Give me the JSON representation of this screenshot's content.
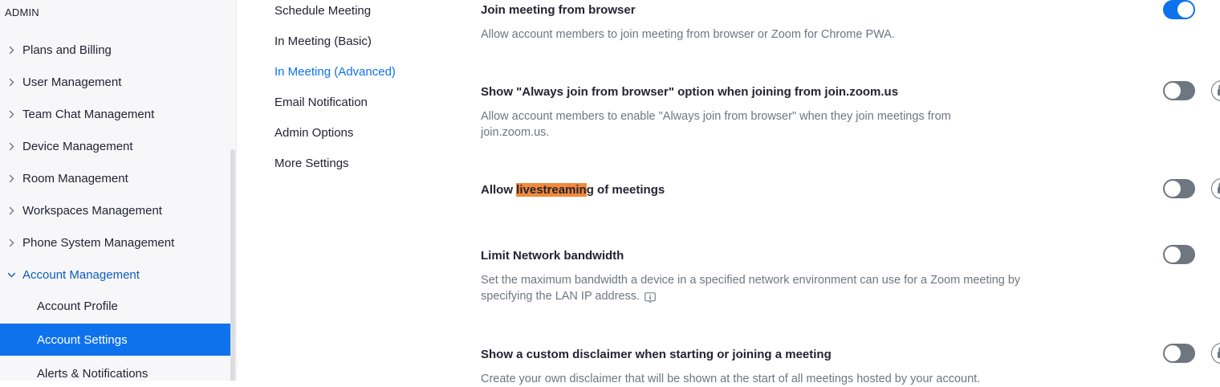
{
  "sidebar": {
    "admin_label": "ADMIN",
    "items": [
      {
        "label": "Plans and Billing"
      },
      {
        "label": "User Management"
      },
      {
        "label": "Team Chat Management"
      },
      {
        "label": "Device Management"
      },
      {
        "label": "Room Management"
      },
      {
        "label": "Workspaces Management"
      },
      {
        "label": "Phone System Management"
      },
      {
        "label": "Account Management"
      }
    ],
    "sub_items": [
      {
        "label": "Account Profile"
      },
      {
        "label": "Account Settings"
      },
      {
        "label": "Alerts & Notifications"
      }
    ]
  },
  "categories": [
    {
      "label": "Schedule Meeting"
    },
    {
      "label": "In Meeting (Basic)"
    },
    {
      "label": "In Meeting (Advanced)"
    },
    {
      "label": "Email Notification"
    },
    {
      "label": "Admin Options"
    },
    {
      "label": "More Settings"
    }
  ],
  "settings": [
    {
      "title": "Join meeting from browser",
      "description": "Allow account members to join meeting from browser or Zoom for Chrome PWA.",
      "enabled": true
    },
    {
      "title": "Show \"Always join from browser\" option when joining from join.zoom.us",
      "description": "Allow account members to enable \"Always join from browser\" when they join meetings from join.zoom.us.",
      "enabled": false
    },
    {
      "title_before": "Allow ",
      "title_highlight": "livestreamin",
      "title_after": "g of meetings",
      "enabled": false
    },
    {
      "title": "Limit Network bandwidth",
      "description": "Set the maximum bandwidth a device in a specified network environment can use for a Zoom meeting by specifying the LAN IP address.",
      "enabled": false
    },
    {
      "title": "Show a custom disclaimer when starting or joining a meeting",
      "description": "Create your own disclaimer that will be shown at the start of all meetings hosted by your account.",
      "enabled": false
    }
  ],
  "colors": {
    "accent": "#0e72ed",
    "active_nav_bg": "#0e72ed",
    "expanded_nav_text": "#0e5bbd",
    "search_highlight": "#f2893a",
    "toggle_off": "#6e7680",
    "muted_text": "#6e7680"
  },
  "icons": {
    "collapsed": "chevron-right-icon",
    "expanded": "chevron-down-icon",
    "lock": "lock-icon",
    "info": "info-icon"
  }
}
